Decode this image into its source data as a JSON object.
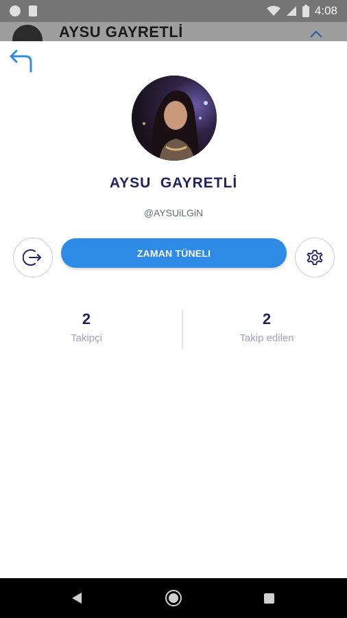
{
  "status_bar": {
    "time": "4:08"
  },
  "background_header": {
    "title": "AYSU  GAYRETLİ"
  },
  "profile": {
    "name": "AYSU  GAYRETLİ",
    "username": "@AYSUiLGiN"
  },
  "actions": {
    "timeline_label": "ZAMAN TÜNELI"
  },
  "stats": {
    "followers": {
      "count": "2",
      "label": "Takipçi"
    },
    "following": {
      "count": "2",
      "label": "Takip edilen"
    }
  },
  "colors": {
    "accent": "#2d8be6",
    "name_text": "#1f2460",
    "muted_text": "#9fa3bd"
  }
}
